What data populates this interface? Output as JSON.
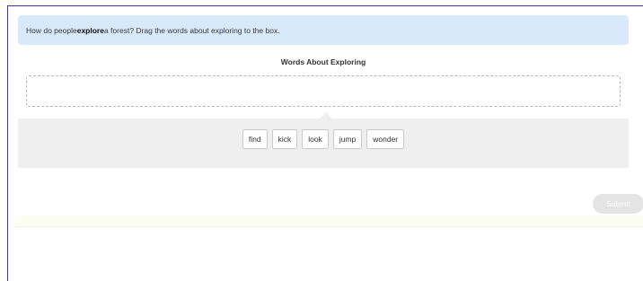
{
  "prompt": {
    "before": "How do people ",
    "emphasis": "explore",
    "after": " a forest? Drag the words about exploring to the box."
  },
  "panel": {
    "title": "Words About Exploring"
  },
  "words": [
    "find",
    "kick",
    "look",
    "jump",
    "wonder"
  ],
  "submit_label": "Submit",
  "colors": {
    "prompt_bg": "#d7e9fb",
    "tray_bg": "#efefef",
    "submit_disabled_bg": "#e4e4e4"
  }
}
